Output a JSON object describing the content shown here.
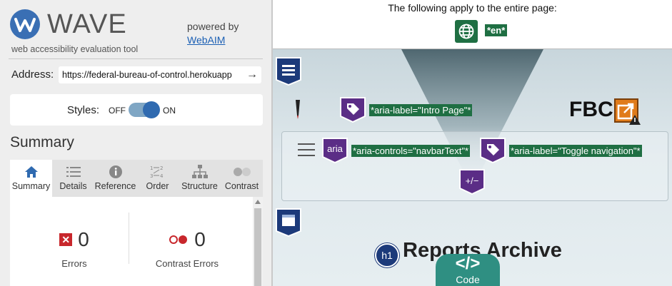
{
  "wave": {
    "logo_text": "WAVE",
    "tagline": "web accessibility evaluation tool",
    "powered_by": "powered by",
    "webaim_link": "WebAIM",
    "address_label": "Address:",
    "address_value": "https://federal-bureau-of-control.herokuapp",
    "styles_label": "Styles:",
    "styles_off": "OFF",
    "styles_on": "ON",
    "summary_heading": "Summary",
    "tabs": [
      {
        "label": "Summary",
        "icon": "home-icon"
      },
      {
        "label": "Details",
        "icon": "list-icon"
      },
      {
        "label": "Reference",
        "icon": "info-icon"
      },
      {
        "label": "Order",
        "icon": "order-icon"
      },
      {
        "label": "Structure",
        "icon": "structure-icon"
      },
      {
        "label": "Contrast",
        "icon": "contrast-icon"
      }
    ],
    "stats": {
      "errors_count": "0",
      "errors_label": "Errors",
      "contrast_count": "0",
      "contrast_label": "Contrast Errors"
    }
  },
  "page": {
    "notice": "The following apply to the entire page:",
    "lang_label": "*en*",
    "intro_label": "*aria-label=\"Intro Page\"*",
    "aria_text": "aria",
    "aria_controls_label": "*aria-controls=\"navbarText\"*",
    "toggle_label": "*aria-label=\"Toggle navigation\"*",
    "plus_minus": "+/−",
    "fbc": "FBC",
    "h1_badge": "h1",
    "heading": "Reports Archive",
    "code_symbol": "</>",
    "code_label": "Code"
  },
  "colors": {
    "wave_blue": "#3a6fb4",
    "structure_blue": "#1c3a7a",
    "aria_purple": "#5b2d86",
    "label_green": "#1f6f43",
    "alert_orange": "#e07b1a",
    "code_teal": "#2f8f82",
    "error_red": "#c8272c"
  }
}
